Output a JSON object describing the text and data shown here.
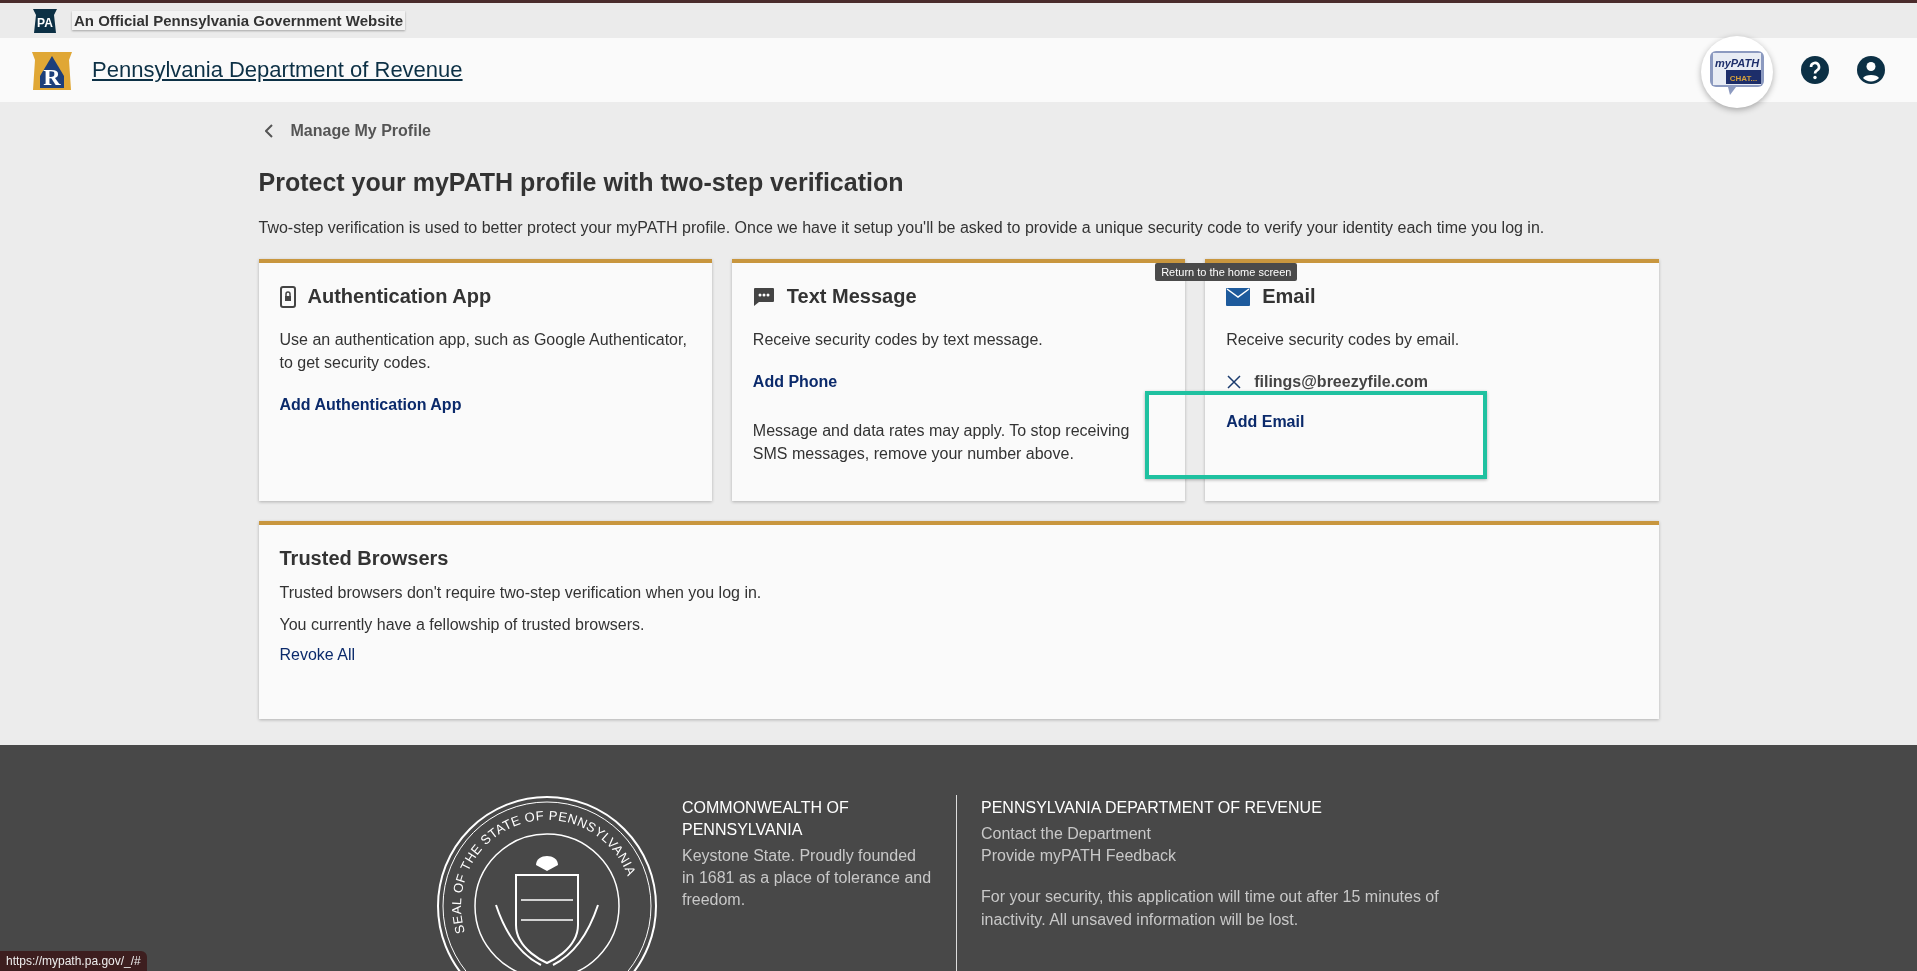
{
  "gov_bar": {
    "badge": "PA",
    "text": "An Official Pennsylvania Government Website"
  },
  "header": {
    "logo_letter": "R",
    "title": "Pennsylvania Department of Revenue",
    "chat_logo": {
      "top": "myPATH",
      "bottom": "CHAT..."
    }
  },
  "back_link": "Manage My Profile",
  "page_title": "Protect your myPATH profile with two-step verification",
  "intro": "Two-step verification is used to better protect your myPATH profile. Once we have it setup you'll be asked to provide a unique security code to verify your identity each time you log in.",
  "methods": [
    {
      "kind": "app",
      "title": "Authentication App",
      "description": "Use an authentication app, such as Google Authenticator, to get security codes.",
      "action": "Add Authentication App"
    },
    {
      "kind": "sms",
      "title": "Text Message",
      "description": "Receive security codes by text message.",
      "action": "Add Phone",
      "note": "Message and data rates may apply. To stop receiving SMS messages, remove your number above."
    },
    {
      "kind": "email",
      "title": "Email",
      "description": "Receive security codes by email.",
      "entries": [
        "filings@breezyfile.com"
      ],
      "action": "Add Email",
      "highlighted": true
    }
  ],
  "tooltip": "Return to the home screen",
  "trusted_browsers": {
    "title": "Trusted Browsers",
    "lines": [
      "Trusted browsers don't require two-step verification when you log in.",
      "You currently have a fellowship of trusted browsers."
    ],
    "action": "Revoke All"
  },
  "footer": {
    "seal_text": "SEAL OF THE STATE OF PENNSYLVANIA",
    "left": {
      "heading": "COMMONWEALTH OF PENNSYLVANIA",
      "text": "Keystone State. Proudly founded in 1681 as a place of tolerance and freedom."
    },
    "right": {
      "heading": "PENNSYLVANIA DEPARTMENT OF REVENUE",
      "links": [
        "Contact the Department",
        "Provide myPATH Feedback"
      ],
      "notice": "For your security, this application will time out after 15 minutes of inactivity. All unsaved information will be lost."
    }
  },
  "status_url": "https://mypath.pa.gov/_/#"
}
